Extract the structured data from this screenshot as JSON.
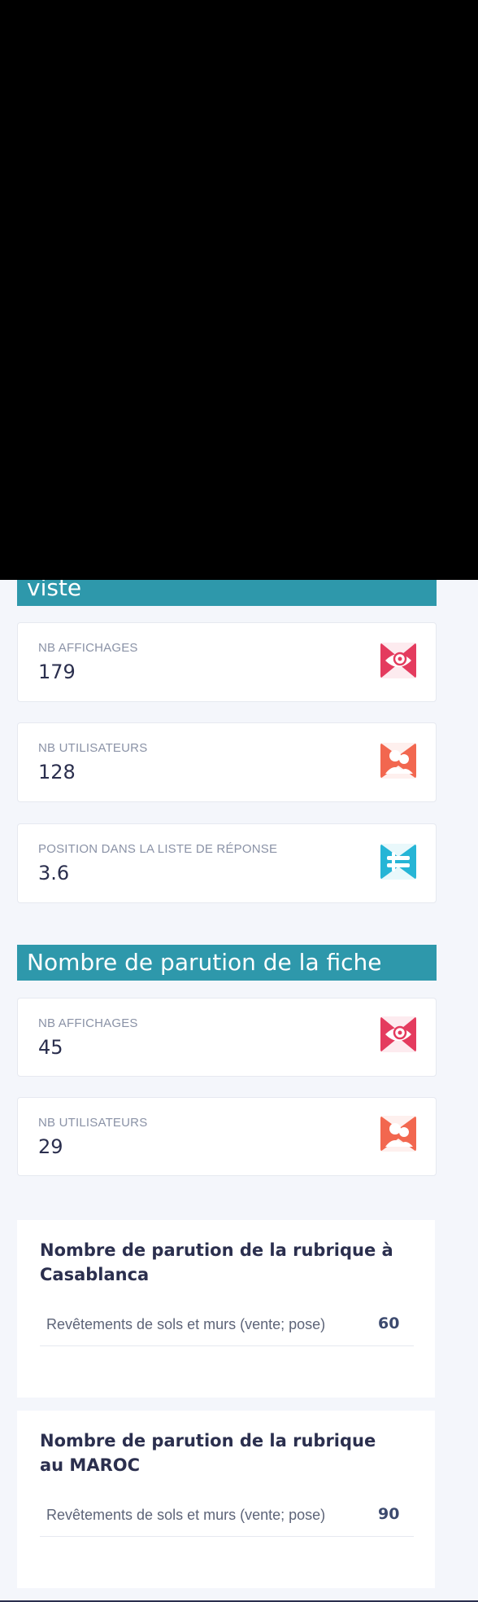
{
  "colors": {
    "header_bg": "#2e98ab",
    "eye_icon": "#e43b5e",
    "users_icon": "#f2674f",
    "list_icon": "#26b5d6"
  },
  "section1": {
    "title_fragment": "viste",
    "stats": [
      {
        "label": "NB AFFICHAGES",
        "value": "179",
        "icon": "eye-icon"
      },
      {
        "label": "NB UTILISATEURS",
        "value": "128",
        "icon": "users-icon"
      },
      {
        "label": "POSITION DANS LA LISTE DE RÉPONSE",
        "value": "3.6",
        "icon": "list-position-icon"
      }
    ]
  },
  "section2": {
    "title": "Nombre de parution de la fiche",
    "stats": [
      {
        "label": "NB AFFICHAGES",
        "value": "45",
        "icon": "eye-icon"
      },
      {
        "label": "NB UTILISATEURS",
        "value": "29",
        "icon": "users-icon"
      }
    ]
  },
  "casablanca": {
    "title": "Nombre de parution de la rubrique à Casablanca",
    "rows": [
      {
        "name": "Revêtements de sols et murs (vente; pose)",
        "count": "60"
      }
    ]
  },
  "maroc": {
    "title": "Nombre de parution de la rubrique au MAROC",
    "rows": [
      {
        "name": "Revêtements de sols et murs (vente; pose)",
        "count": "90"
      }
    ]
  }
}
